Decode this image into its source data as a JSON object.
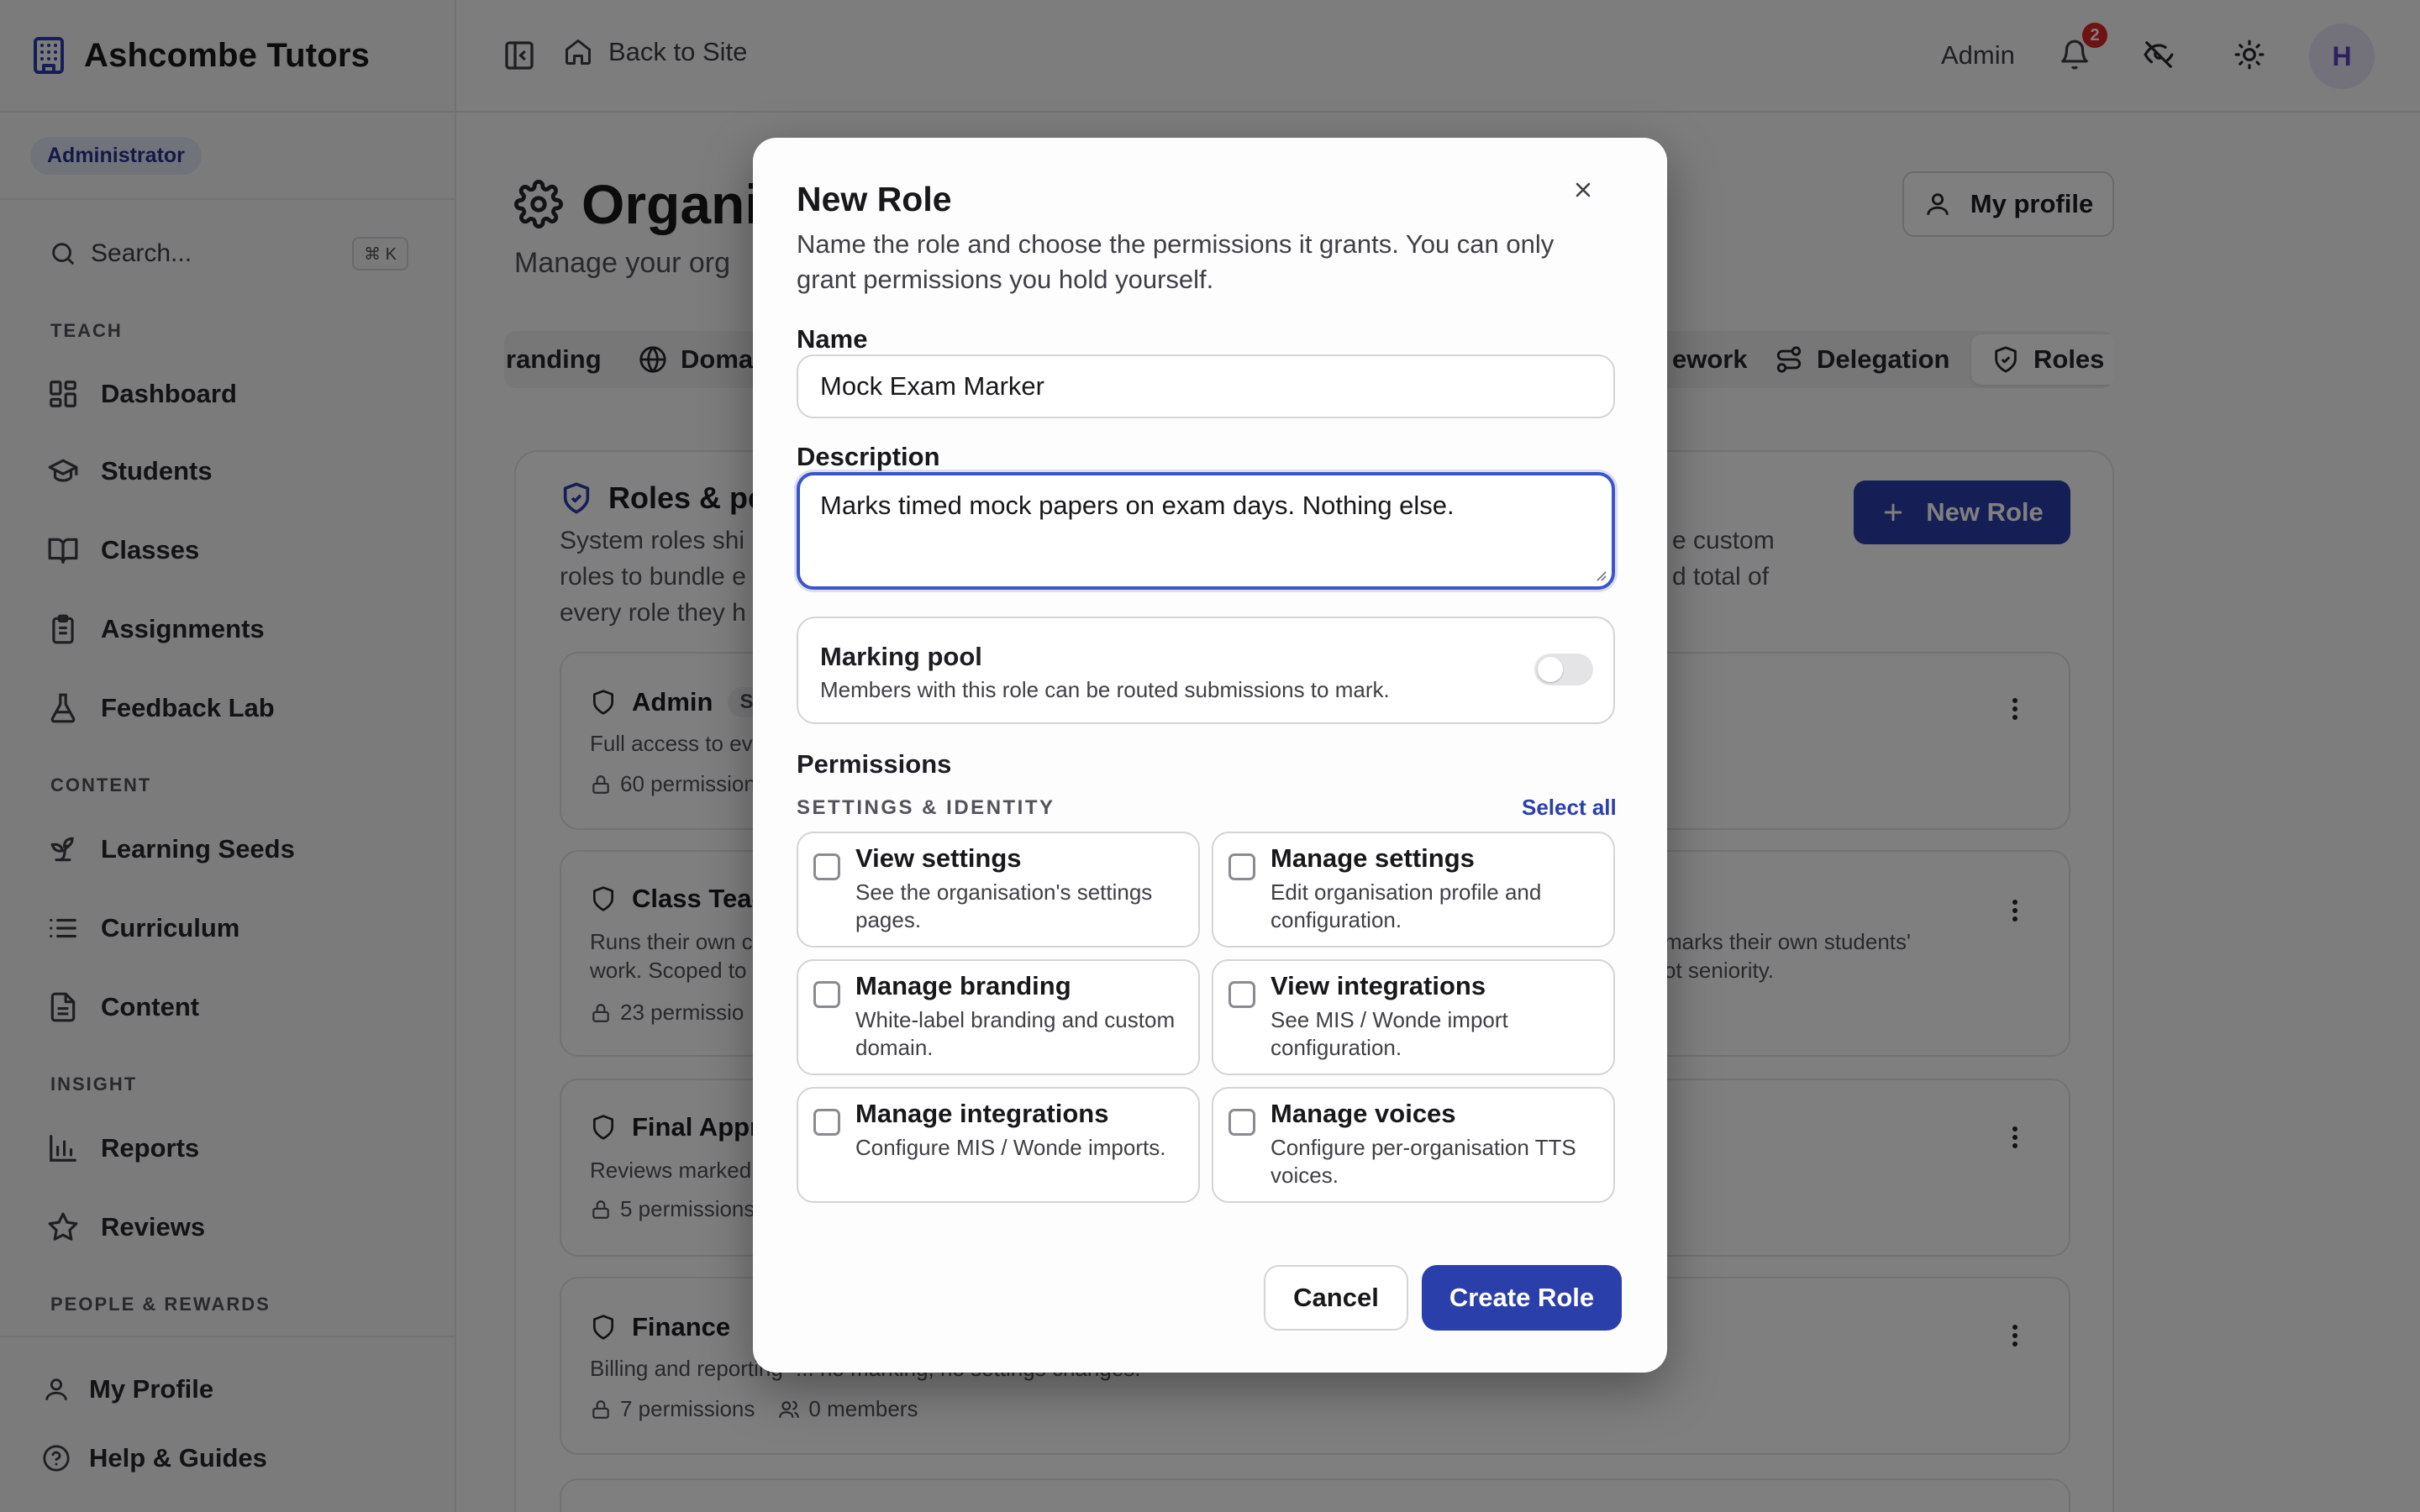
{
  "app": {
    "name": "Ashcombe Tutors",
    "role_badge": "Administrator"
  },
  "sidebar": {
    "search_placeholder": "Search...",
    "search_shortcut": "⌘ K",
    "sections": {
      "teach": "TEACH",
      "content": "CONTENT",
      "insight": "INSIGHT",
      "people": "PEOPLE & REWARDS"
    },
    "items": [
      {
        "label": "Dashboard",
        "icon": "dashboard-icon"
      },
      {
        "label": "Students",
        "icon": "graduation-cap-icon"
      },
      {
        "label": "Classes",
        "icon": "book-open-icon"
      },
      {
        "label": "Assignments",
        "icon": "clipboard-icon"
      },
      {
        "label": "Feedback Lab",
        "icon": "flask-icon"
      },
      {
        "label": "Learning Seeds",
        "icon": "sprout-icon"
      },
      {
        "label": "Curriculum",
        "icon": "list-icon"
      },
      {
        "label": "Content",
        "icon": "file-text-icon"
      },
      {
        "label": "Reports",
        "icon": "bar-chart-icon"
      },
      {
        "label": "Reviews",
        "icon": "star-icon"
      }
    ],
    "bottom": [
      {
        "label": "My Profile",
        "icon": "user-icon"
      },
      {
        "label": "Help & Guides",
        "icon": "help-circle-icon"
      }
    ]
  },
  "topbar": {
    "back_label": "Back to Site",
    "admin_label": "Admin",
    "notification_count": "2",
    "avatar_initial": "H"
  },
  "page": {
    "title": "Organi",
    "subtitle": "Manage your org",
    "my_profile_label": "My profile",
    "tabs": [
      {
        "label": "randing"
      },
      {
        "label": "Doma"
      },
      {
        "label": "ework"
      },
      {
        "label": "Delegation"
      },
      {
        "label": "Roles"
      }
    ]
  },
  "roles_card": {
    "title": "Roles & pe",
    "desc_line1_left": "System roles shi",
    "desc_line1_right": "e custom",
    "desc_line2_left": "roles to bundle e",
    "desc_line2_right": "d total of",
    "desc_line3_left": "every role they h",
    "new_role_label": "New Role",
    "roles": [
      {
        "name": "Admin",
        "chip": "S",
        "desc": "Full access to ev",
        "meta": "60 permission"
      },
      {
        "name": "Class Teac",
        "desc1": "Runs their own c",
        "desc1_right": "marks their own students'",
        "desc2": "work. Scoped to",
        "desc2_right": "ot seniority.",
        "meta": "23 permissio"
      },
      {
        "name": "Final Appr",
        "desc": "Reviews marked",
        "meta": "5 permissions"
      },
      {
        "name": "Finance",
        "desc_left": "Billing and reporting",
        "desc_right": "... no marking, no settings changes.",
        "meta": "7 permissions",
        "members": "0 members"
      }
    ]
  },
  "modal": {
    "title": "New Role",
    "description": "Name the role and choose the permissions it grants. You can only grant permissions you hold yourself.",
    "name_label": "Name",
    "name_value": "Mock Exam Marker",
    "description_label": "Description",
    "description_value": "Marks timed mock papers on exam days. Nothing else.",
    "marking_pool": {
      "title": "Marking pool",
      "subtitle": "Members with this role can be routed submissions to mark.",
      "enabled": false
    },
    "permissions_label": "Permissions",
    "group_label": "SETTINGS & IDENTITY",
    "select_all_label": "Select all",
    "permissions": [
      {
        "title": "View settings",
        "desc": "See the organisation's settings pages.",
        "checked": false
      },
      {
        "title": "Manage settings",
        "desc": "Edit organisation profile and configuration.",
        "checked": false
      },
      {
        "title": "Manage branding",
        "desc": "White-label branding and custom domain.",
        "checked": false
      },
      {
        "title": "View integrations",
        "desc": "See MIS / Wonde import configuration.",
        "checked": false
      },
      {
        "title": "Manage integrations",
        "desc": "Configure MIS / Wonde imports.",
        "checked": false
      },
      {
        "title": "Manage voices",
        "desc": "Configure per-organisation TTS voices.",
        "checked": false
      }
    ],
    "cancel_label": "Cancel",
    "create_label": "Create Role"
  },
  "colors": {
    "accent": "#2a3faa",
    "focus_ring": "#3b55c9",
    "notification": "#dc2626",
    "overlay": "rgba(0,0,0,0.5)"
  }
}
